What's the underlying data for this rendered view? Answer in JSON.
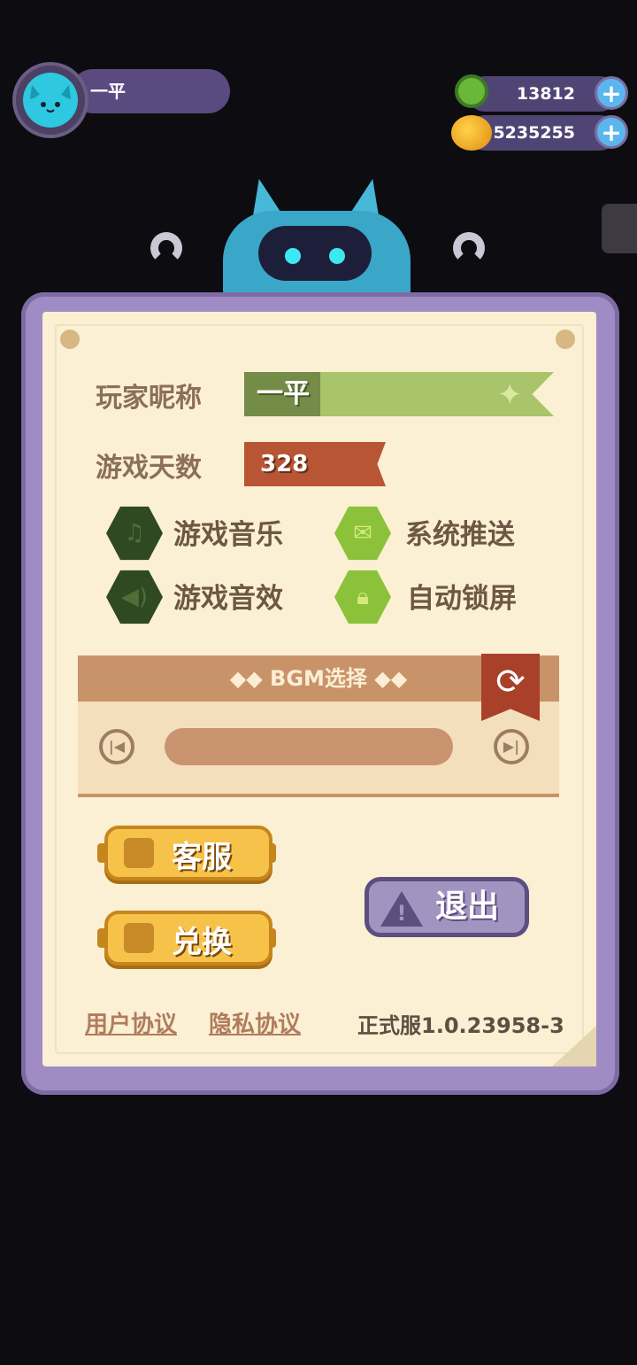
{
  "player": {
    "name": "一平"
  },
  "currency": {
    "green_value": "13812",
    "gold_value": "5235255",
    "plus": "+"
  },
  "settings": {
    "nickname_label": "玩家昵称",
    "nickname_value": "一平",
    "days_label": "游戏天数",
    "days_value": "328",
    "options": {
      "music": "游戏音乐",
      "sfx": "游戏音效",
      "push": "系统推送",
      "autolock": "自动锁屏"
    },
    "bgm_title": "◆◆ BGM选择 ◆◆"
  },
  "buttons": {
    "service": "客服",
    "redeem": "兑换",
    "logout": "退出"
  },
  "footer": {
    "user_agreement": "用户协议",
    "privacy": "隐私协议",
    "version": "正式服1.0.23958-3"
  },
  "colors": {
    "panel": "#a08cc4",
    "paper": "#fbf0d3",
    "accent_green": "#8cc23a",
    "accent_orange": "#b85534"
  }
}
